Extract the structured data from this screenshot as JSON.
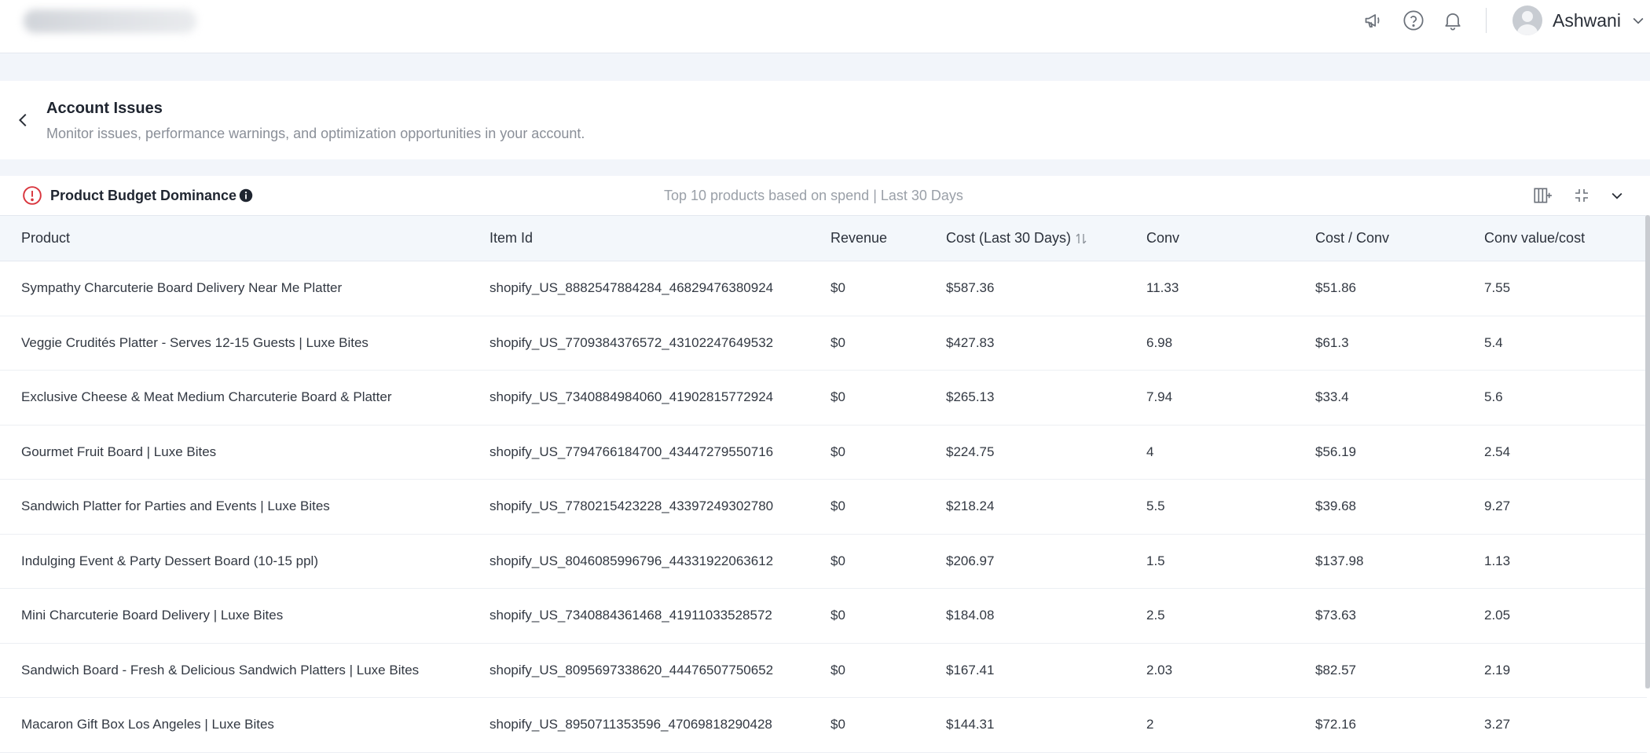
{
  "header": {
    "user_name": "Ashwani",
    "icons": [
      "megaphone-icon",
      "help-icon",
      "bell-icon"
    ]
  },
  "page": {
    "title": "Account Issues",
    "subtitle": "Monitor issues, performance warnings, and optimization opportunities in your account."
  },
  "card": {
    "title": "Product Budget Dominance",
    "caption": "Top 10 products based on spend | Last 30 Days"
  },
  "table": {
    "columns": [
      "Product",
      "Item Id",
      "Revenue",
      "Cost (Last 30 Days)",
      "Conv",
      "Cost / Conv",
      "Conv value/cost"
    ],
    "rows": [
      [
        "Sympathy Charcuterie Board Delivery Near Me Platter",
        "shopify_US_8882547884284_46829476380924",
        "$0",
        "$587.36",
        "11.33",
        "$51.86",
        "7.55"
      ],
      [
        "Veggie Crudités Platter - Serves 12-15 Guests | Luxe Bites",
        "shopify_US_7709384376572_43102247649532",
        "$0",
        "$427.83",
        "6.98",
        "$61.3",
        "5.4"
      ],
      [
        "Exclusive Cheese & Meat Medium Charcuterie Board & Platter",
        "shopify_US_7340884984060_41902815772924",
        "$0",
        "$265.13",
        "7.94",
        "$33.4",
        "5.6"
      ],
      [
        "Gourmet Fruit Board | Luxe Bites",
        "shopify_US_7794766184700_43447279550716",
        "$0",
        "$224.75",
        "4",
        "$56.19",
        "2.54"
      ],
      [
        "Sandwich Platter for Parties and Events | Luxe Bites",
        "shopify_US_7780215423228_43397249302780",
        "$0",
        "$218.24",
        "5.5",
        "$39.68",
        "9.27"
      ],
      [
        "Indulging Event & Party Dessert Board (10-15 ppl)",
        "shopify_US_8046085996796_44331922063612",
        "$0",
        "$206.97",
        "1.5",
        "$137.98",
        "1.13"
      ],
      [
        "Mini Charcuterie Board Delivery | Luxe Bites",
        "shopify_US_7340884361468_41911033528572",
        "$0",
        "$184.08",
        "2.5",
        "$73.63",
        "2.05"
      ],
      [
        "Sandwich Board - Fresh & Delicious Sandwich Platters | Luxe Bites",
        "shopify_US_8095697338620_44476507750652",
        "$0",
        "$167.41",
        "2.03",
        "$82.57",
        "2.19"
      ],
      [
        "Macaron Gift Box Los Angeles | Luxe Bites",
        "shopify_US_8950711353596_47069818290428",
        "$0",
        "$144.31",
        "2",
        "$72.16",
        "3.27"
      ]
    ]
  },
  "colors": {
    "alert": "#d9363e",
    "page_bg": "#f2f5fa",
    "header_row_bg": "#f3f7fb"
  }
}
